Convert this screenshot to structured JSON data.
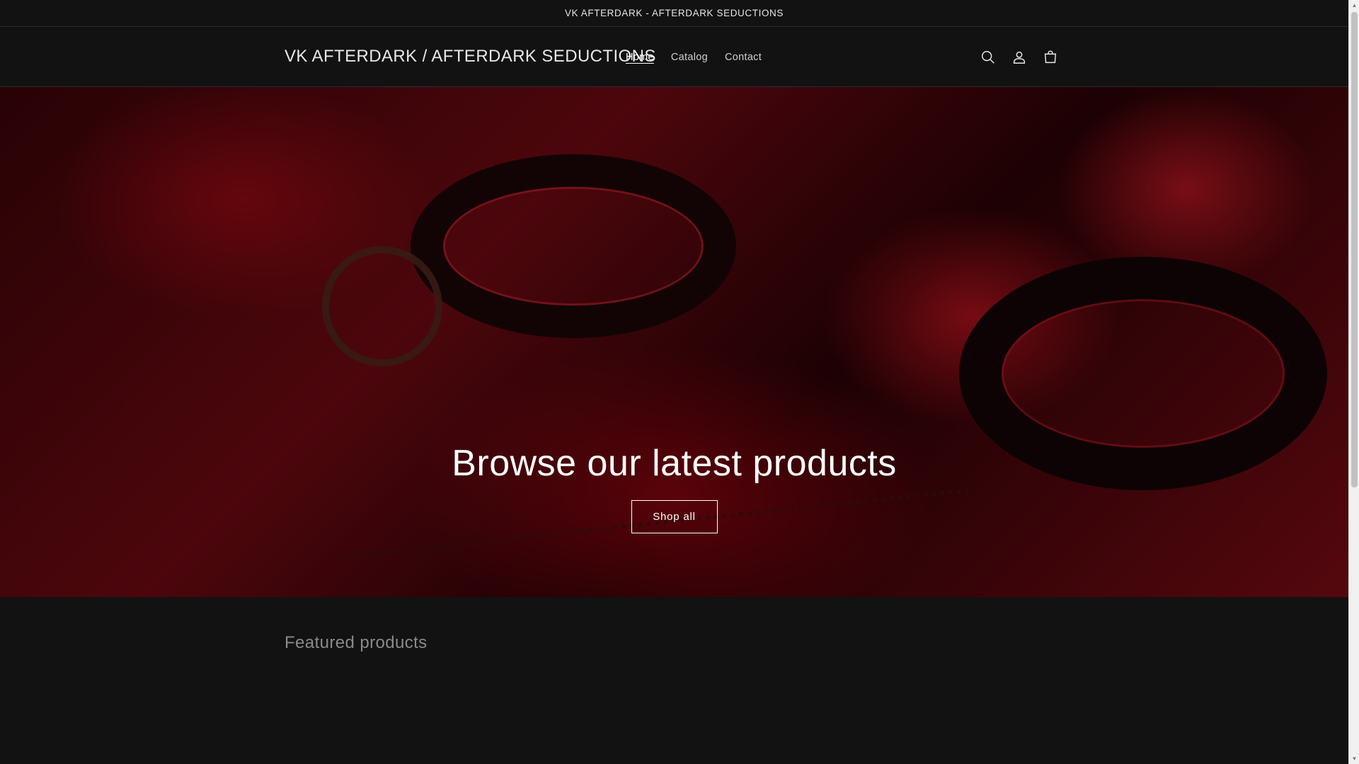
{
  "announcement": {
    "text": "VK AFTERDARK - AFTERDARK SEDUCTIONS"
  },
  "header": {
    "logo": "VK AFTERDARK / AFTERDARK SEDUCTIONS",
    "nav": [
      {
        "label": "Home",
        "active": true
      },
      {
        "label": "Catalog",
        "active": false
      },
      {
        "label": "Contact",
        "active": false
      }
    ],
    "icons": [
      "search-icon",
      "account-icon",
      "cart-icon"
    ]
  },
  "hero": {
    "title": "Browse our latest products",
    "button_label": "Shop all"
  },
  "featured": {
    "heading": "Featured products"
  },
  "colors": {
    "background": "#121212",
    "hero_accent": "#7a0c14",
    "text": "#ffffff",
    "muted": "#8a8a8a"
  }
}
